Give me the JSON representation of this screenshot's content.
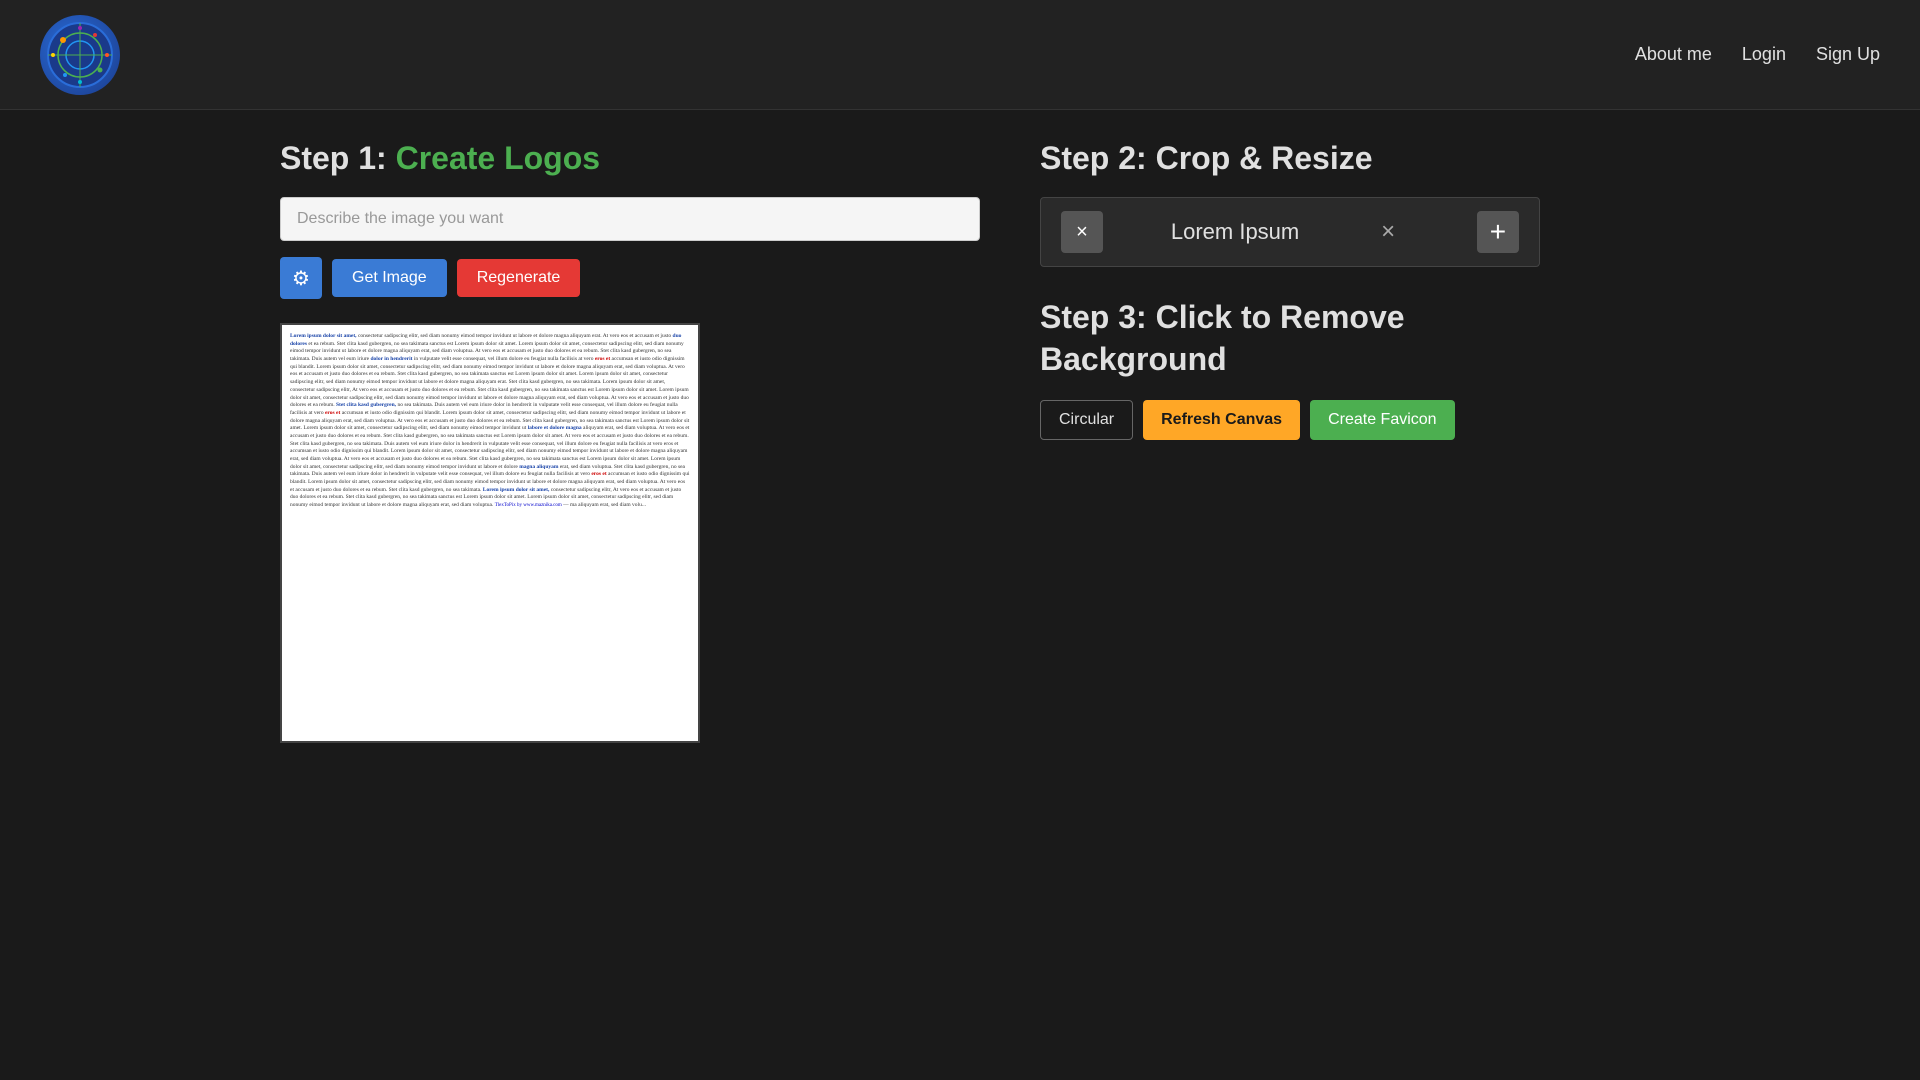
{
  "header": {
    "nav": {
      "about_label": "About me",
      "login_label": "Login",
      "signup_label": "Sign Up"
    }
  },
  "step1": {
    "title_step": "Step 1:",
    "title_action": "Create Logos",
    "input_placeholder": "Describe the image you want",
    "get_image_label": "Get Image",
    "regenerate_label": "Regenerate"
  },
  "step2": {
    "title_step": "Step 2:",
    "title_action": "Crop & Resize",
    "crop_label": "Lorem Ipsum",
    "x_left_label": "×",
    "close_label": "×",
    "plus_label": "+"
  },
  "step3": {
    "title_step": "Step 3:",
    "title_action": "Click to Remove",
    "title_action2": "Background",
    "circular_label": "Circular",
    "refresh_label": "Refresh Canvas",
    "create_favicon_label": "Create Favicon"
  },
  "lorem_short": "Lorem Ipsum dolor sit amet, consectetur sadipscing elitr, sed diam nonumy eimod tempor invidunt ut labore et dolore magna aliquyam erat, sed diam voluptua. At vero eos et accusam et justo duo dolores et ea rebum. Stet clita kasd gubergren, no sea takimata sanctus est Lorem ipsum dolor sit amet. Lorem ipsum dolor sit amet, consectetur sadipscing elitr, sed diam nonumy eimod tempor invidunt ut labore et dolore magna aliquyam erat, sed diam voluptua. At vero eos et accusam et justo duo dolores et ea rebum. Stet clita kasd gubergren, no sea takimata sanctus est Lorem ipsum dolor sit amet. Lorem ipsum dolor sit amet, consectetur sadipscing elitr, At vero eos et accusam et justo duo dolores et ea rebum. Stet clita kasd gubergren, no sea takimata. Duis autem vel eum iriure dolor in hendrerit in vulputate velit esse consequat, vel illum dolore eu feugiat nulla facilisis at vero eros et accumsan et iusto odio dignissim qui blandit. Lorem ipsum dolor sit amet, consectetur sadipscing elitr, sed diam nonumy eimod tempor invidunt ut labore et dolore magna aliquyam erat, sed diam voluptua. At vero eos et accusam et justo duo dolores et ea rebum. Stet clita kasd gubergren, no sea takimata sanctus est Lorem ipsum dolor sit amet. Lorem ipsum dolor sit amet, consectetur sadipscing elitr, sed diam nonumy eimod tempor invidunt ut labore et dolore magna aliquyam erat, sed diam voluptua."
}
